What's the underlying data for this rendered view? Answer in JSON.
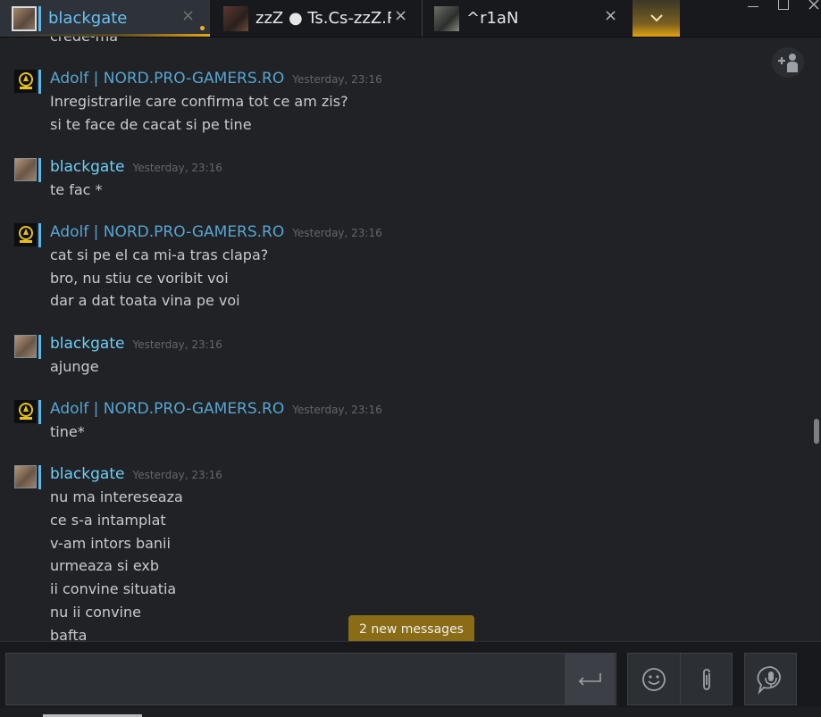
{
  "tabs": [
    {
      "label": "blackgate",
      "active": true,
      "unread": true
    },
    {
      "label": "zzZ ● Ts.Cs-zzZ.Ro",
      "active": false
    },
    {
      "label": "^r1aN",
      "active": false
    }
  ],
  "tab_close_glyph": "×",
  "colors": {
    "accent_gold": "#e3a10f",
    "online_name": "#6dcff6",
    "steam_name": "#57a5d2",
    "status_bar": "#5ab9ea"
  },
  "chat": {
    "cut_line": "crede-ma",
    "groups": [
      {
        "author": "Adolf | NORD.PRO-GAMERS.RO",
        "avatar": "nord-logo",
        "time": "Yesterday, 23:16",
        "lines": [
          "Inregistrarile care confirma tot ce am zis?",
          "si te face de cacat si pe tine"
        ]
      },
      {
        "author": "blackgate",
        "avatar": "user-photo",
        "time": "Yesterday, 23:16",
        "lines": [
          "te fac *"
        ]
      },
      {
        "author": "Adolf | NORD.PRO-GAMERS.RO",
        "avatar": "nord-logo",
        "time": "Yesterday, 23:16",
        "lines": [
          "cat si pe el ca mi-a tras clapa?",
          "bro, nu stiu ce voribit voi",
          "dar a dat toata vina pe voi"
        ]
      },
      {
        "author": "blackgate",
        "avatar": "user-photo",
        "time": "Yesterday, 23:16",
        "lines": [
          "ajunge"
        ]
      },
      {
        "author": "Adolf | NORD.PRO-GAMERS.RO",
        "avatar": "nord-logo",
        "time": "Yesterday, 23:16",
        "lines": [
          "tine*"
        ]
      },
      {
        "author": "blackgate",
        "avatar": "user-photo",
        "time": "Yesterday, 23:16",
        "lines": [
          "nu ma intereseaza",
          "ce s-a intamplat",
          "v-am intors banii",
          "urmeaza si exb",
          "ii convine situatia",
          "nu ii convine",
          "bafta"
        ]
      }
    ]
  },
  "new_messages_label": "2 new messages",
  "composer": {
    "value": "",
    "placeholder": ""
  },
  "icons": {
    "more_tabs": "chevron-down-icon",
    "add_friend": "add-friend-icon",
    "send": "enter-icon",
    "emoji": "smiley-icon",
    "attach": "paperclip-icon",
    "voice": "microphone-bubble-icon"
  }
}
